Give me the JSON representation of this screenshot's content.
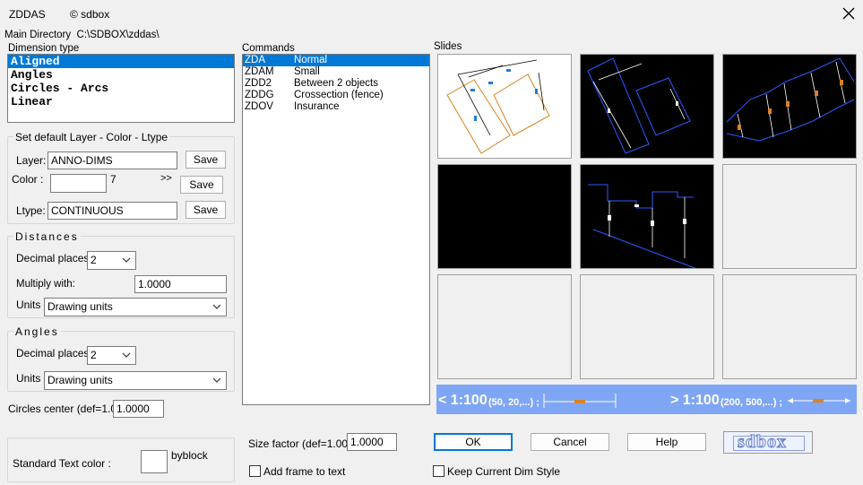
{
  "window": {
    "app_name": "ZDDAS",
    "copyright": "© sdbox",
    "main_directory_label": "Main Directory",
    "main_directory_value": "C:\\SDBOX\\zddas\\"
  },
  "dimension_type": {
    "label": "Dimension type",
    "items": [
      "Aligned",
      "Angles",
      "Circles - Arcs",
      "Linear"
    ],
    "selected_index": 0
  },
  "layer_group": {
    "title": "Set default Layer - Color - Ltype",
    "layer_label": "Layer:",
    "layer_value": "ANNO-DIMS",
    "color_label": "Color  :",
    "color_value": "7",
    "color_more": ">>",
    "ltype_label": "Ltype:",
    "ltype_value": "CONTINUOUS",
    "save_label": "Save"
  },
  "distances": {
    "title": "Distances",
    "decimal_label": "Decimal places",
    "decimal_value": "2",
    "multiply_label": "Multiply with:",
    "multiply_value": "1.0000",
    "units_label": "Units",
    "units_value": "Drawing units"
  },
  "angles": {
    "title": "Angles",
    "decimal_label": "Decimal places",
    "decimal_value": "2",
    "units_label": "Units",
    "units_value": "Drawing units"
  },
  "circles_center": {
    "label": "Circles center (def=1.0):",
    "value": "1.0000"
  },
  "text_color": {
    "label": "Standard Text color :",
    "byblock": "byblock"
  },
  "commands": {
    "label": "Commands",
    "items": [
      {
        "code": "ZDA",
        "sep": "______",
        "desc": "Normal"
      },
      {
        "code": "ZDAM",
        "sep": "____",
        "desc": "Small"
      },
      {
        "code": "ZDD2",
        "sep": "____",
        "desc": "Between 2 objects"
      },
      {
        "code": "ZDDG",
        "sep": "____",
        "desc": "Crossection (fence)"
      },
      {
        "code": "ZDOV",
        "sep": "____",
        "desc": "Insurance"
      }
    ],
    "selected_index": 0
  },
  "size_factor": {
    "label": "Size factor (def=1.00):",
    "value": "1.0000"
  },
  "add_frame": {
    "label": "Add frame to text",
    "checked": false
  },
  "slides": {
    "label": "Slides"
  },
  "scale_bar": {
    "left_main": "< 1:100",
    "left_small": "(50, 20,...)  ;",
    "right_main": "> 1:100",
    "right_small": "(200, 500,...)  ;"
  },
  "buttons": {
    "ok": "OK",
    "cancel": "Cancel",
    "help": "Help"
  },
  "keep_style": {
    "label": "Keep Current Dim Style",
    "checked": false
  },
  "logo": {
    "text": "sdbox"
  },
  "colors": {
    "selection": "#0078d7",
    "scale_bar": "#7fa6f5",
    "orange": "#d98324",
    "blue_dim": "#1e7fd8"
  }
}
